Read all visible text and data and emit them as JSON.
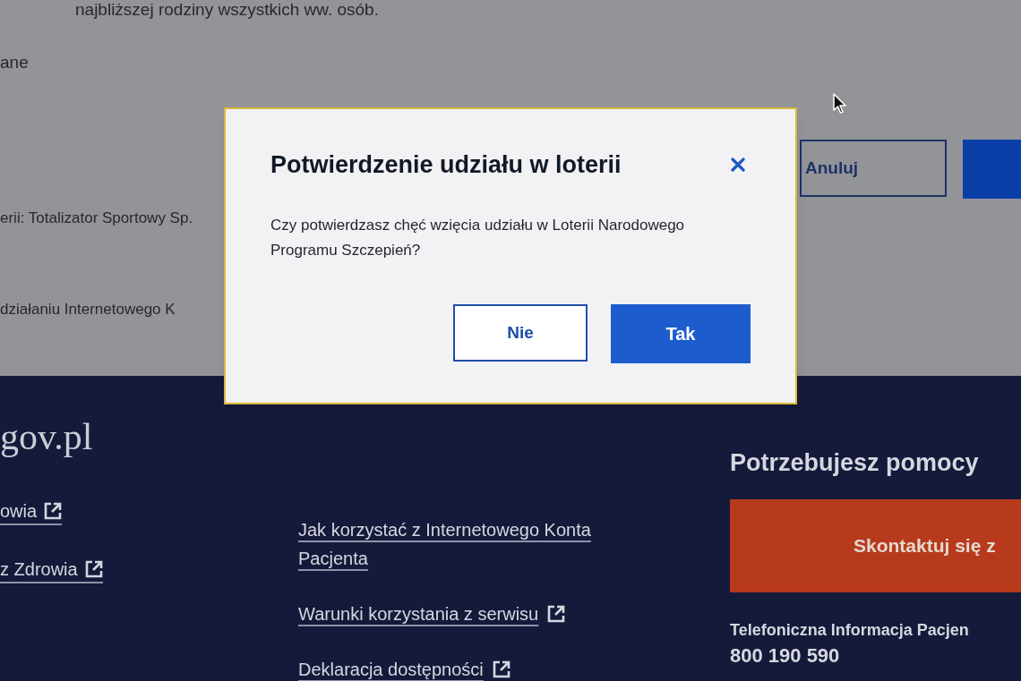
{
  "page": {
    "text_lines": [
      "najbliższej rodziny wszystkich ww. osób.",
      "ane",
      "erii: Totalizator Sportowy Sp.",
      "działaniu Internetowego K"
    ],
    "buttons": [
      {
        "kind": "secondary",
        "label": "Anuluj"
      },
      {
        "kind": "primary"
      }
    ]
  },
  "dialog": {
    "title": "Potwierdzenie udziału w loterii",
    "message": "Czy potwierdzasz chęć wzięcia udziału w Loterii Narodowego Programu Szczepień?",
    "buttons": [
      {
        "kind": "secondary",
        "label": "Nie"
      },
      {
        "kind": "primary",
        "label": "Tak"
      }
    ]
  },
  "footer": {
    "logo": "gov.pl",
    "links_left": [
      {
        "label": "owia",
        "external": true
      },
      {
        "label": "z Zdrowia",
        "external": true
      }
    ],
    "links_middle": [
      {
        "label": "Jak korzystać z Internetowego Konta Pacjenta",
        "external": false
      },
      {
        "label": "Warunki korzystania z serwisu",
        "external": true
      },
      {
        "label": "Deklaracja dostępności",
        "external": true
      }
    ],
    "help": {
      "title": "Potrzebujesz pomocy",
      "button": "Skontaktuj się z",
      "phone_label": "Telefoniczna Informacja Pacjen",
      "phone": "800 190 590"
    }
  }
}
